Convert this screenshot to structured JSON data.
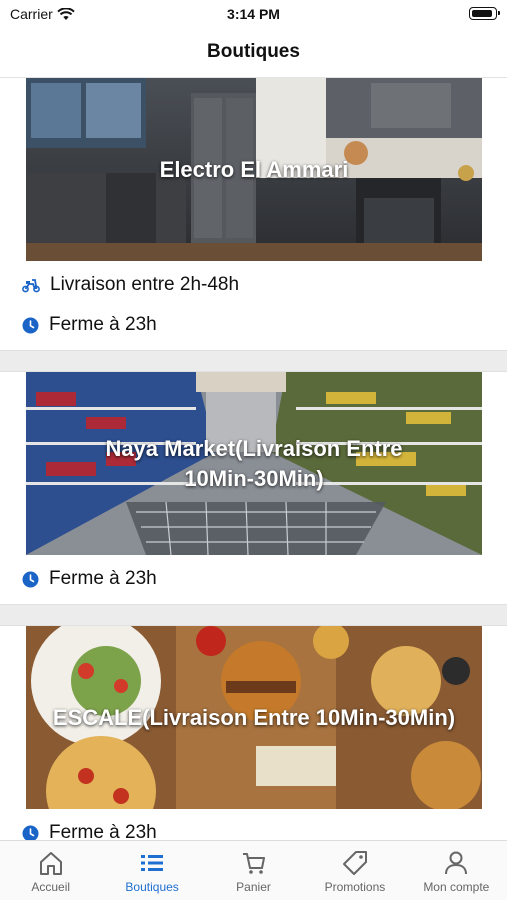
{
  "status_bar": {
    "carrier": "Carrier",
    "time": "3:14 PM"
  },
  "header": {
    "title": "Boutiques"
  },
  "colors": {
    "accent": "#1f6fd1",
    "icon_blue": "#1a64c8"
  },
  "shops": [
    {
      "name": "Electro El Ammari",
      "delivery": "Livraison entre 2h-48h",
      "hours": "Ferme à 23h"
    },
    {
      "name": "Naya Market(Livraison Entre\n10Min-30Min)",
      "hours": "Ferme à 23h"
    },
    {
      "name": "ESCALE(Livraison Entre 10Min-30Min)",
      "hours": "Ferme à 23h"
    }
  ],
  "tabs": [
    {
      "label": "Accueil",
      "icon": "home-icon",
      "active": false
    },
    {
      "label": "Boutiques",
      "icon": "list-icon",
      "active": true
    },
    {
      "label": "Panier",
      "icon": "cart-icon",
      "active": false
    },
    {
      "label": "Promotions",
      "icon": "tag-icon",
      "active": false
    },
    {
      "label": "Mon compte",
      "icon": "user-icon",
      "active": false
    }
  ]
}
